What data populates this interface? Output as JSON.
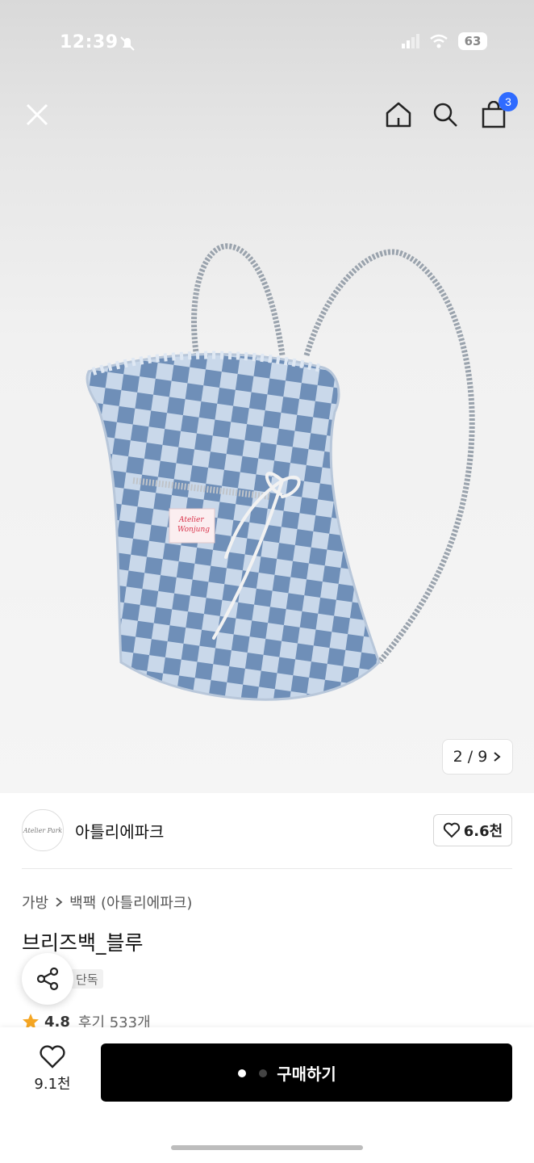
{
  "status_bar": {
    "time": "12:39",
    "battery": "63"
  },
  "header": {
    "cart_count": "3"
  },
  "gallery": {
    "counter": "2 / 9"
  },
  "store": {
    "logo_text": "Atelier Park",
    "name": "아틀리에파크",
    "favorite_count": "6.6천"
  },
  "breadcrumb": {
    "level1": "가방",
    "level2": "백팩 (아틀리에파크)"
  },
  "product": {
    "title": "브리즈백_블루",
    "tag": "단독",
    "rating": "4.8",
    "reviews": "후기 533개"
  },
  "bottom_bar": {
    "like_count": "9.1천",
    "buy_label": "구매하기"
  },
  "bag_label": {
    "line1": "Atelier",
    "line2": "Wonjung"
  },
  "colors": {
    "accent_badge": "#2f6bff",
    "star": "#f5a623",
    "buy_button": "#000000",
    "denim_dark": "#6f8fb8",
    "denim_light": "#c9d8ea"
  }
}
